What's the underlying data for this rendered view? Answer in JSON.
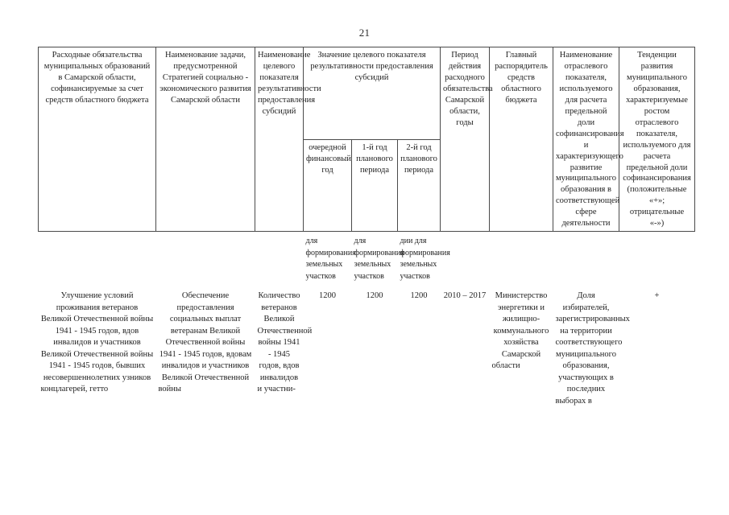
{
  "document": {
    "page_number": "21"
  },
  "table": {
    "headers": {
      "col1": "Расходные обязательства муниципальных образований в Самарской области, софинансируемые за счет средств областного бюджета",
      "col2": "Наименование задачи, предусмотренной Стратегией социально - экономического развития Самарской области",
      "col3": "Наименование целевого показателя результативности предоставления субсидий",
      "group_value": "Значение целевого показателя результативности предоставления субсидий",
      "col4": "очередной финансовый год",
      "col5": "1-й год планового периода",
      "col6": "2-й год планового периода",
      "col7": "Период действия расходного обязательства Самарской области, годы",
      "col8": "Главный распорядитель средств областного бюджета",
      "col9": "Наименование отраслевого показателя, используемого для расчета предельной доли софинансирования и характеризующего развитие муниципального образования в соответствующей сфере деятельности",
      "col10": "Тенденции развития муниципального образования, характеризуемые ростом отраслевого показателя, используемого для расчета предельной доли софинансирования (положительные «+»; отрицательные «-»)"
    },
    "note_row": {
      "col4": "для формирования земельных участков",
      "col5": "для формирования земельных участков",
      "col6": "дии для формирования земельных участков"
    },
    "rows": [
      {
        "col1": "Улучшение условий проживания ветеранов Великой Отечественной войны 1941 - 1945 годов, вдов инвалидов и участников Великой Отечественной войны 1941 - 1945 годов, бывших несовершеннолетних узников концлагерей, гетто",
        "col2": "Обеспечение предоставления социальных выплат ветеранам Великой Отечественной войны 1941 - 1945 годов, вдовам инвалидов и участников Великой Отечественной войны",
        "col3": "Количество ветеранов Великой Отечественной войны 1941 - 1945 годов, вдов инвалидов и участни-",
        "col4": "1200",
        "col5": "1200",
        "col6": "1200",
        "col7": "2010 – 2017",
        "col8": "Министерство энергетики и жилищно-коммунального хозяйства Самарской области",
        "col9": "Доля избирателей, зарегистрированных на территории соответствующего муниципального образования, участвующих в последних выборах в",
        "col10": "+"
      }
    ]
  }
}
